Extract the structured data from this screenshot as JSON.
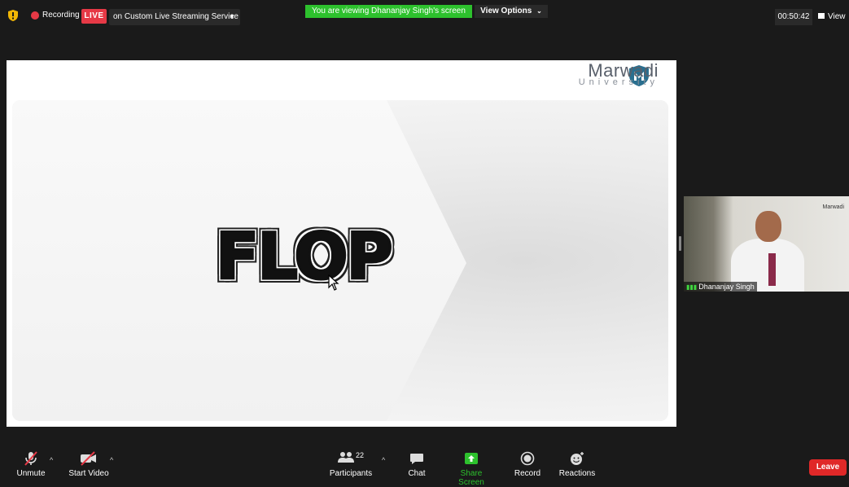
{
  "top_bar": {
    "recording_label": "Recording",
    "live_badge": "LIVE",
    "stream_target": "on Custom Live Streaming Service",
    "viewing_banner": "You are viewing Dhananjay Singh's screen",
    "view_options": "View Options",
    "timer": "00:50:42",
    "view_label": "View"
  },
  "slide": {
    "logo_name": "Marwadi",
    "logo_sub": "University",
    "headline": "FLOP"
  },
  "participant_tile": {
    "name": "Dhananjay Singh",
    "logo_text": "Marwadi"
  },
  "toolbar": {
    "unmute": "Unmute",
    "start_video": "Start Video",
    "participants": "Participants",
    "participant_count": "22",
    "chat": "Chat",
    "share_screen": "Share Screen",
    "record": "Record",
    "reactions": "Reactions",
    "leave": "Leave"
  },
  "colors": {
    "live_red": "#e63946",
    "banner_green": "#2dc12d",
    "share_green": "#2dc12d",
    "leave_red": "#e02828"
  }
}
